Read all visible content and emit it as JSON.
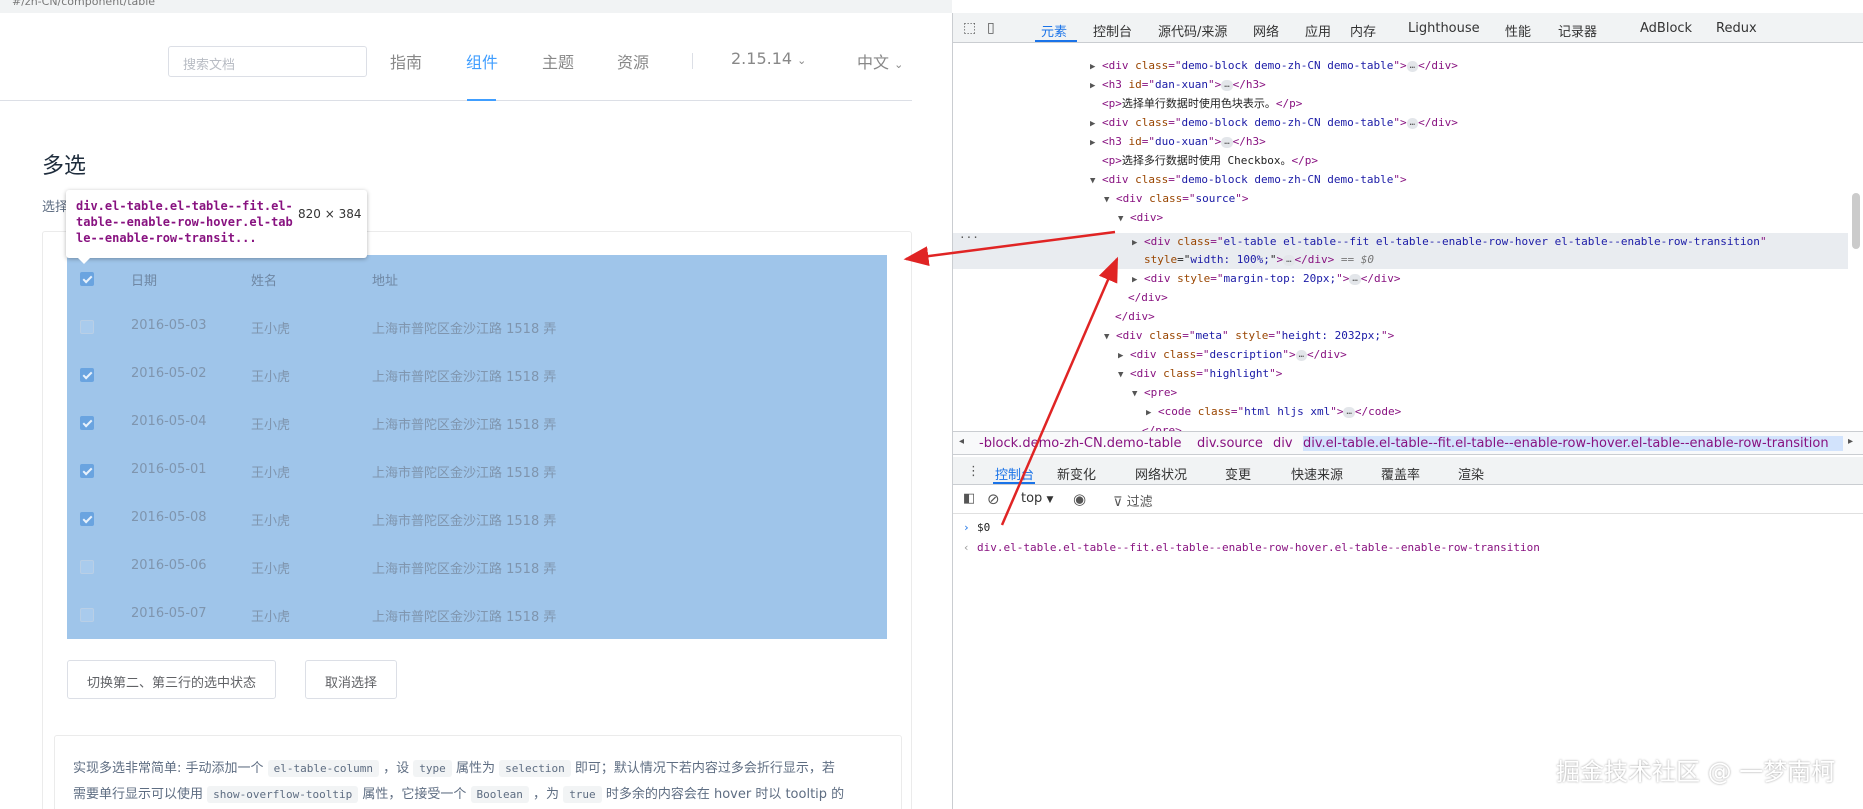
{
  "browser": {
    "url_fragment": "#/zh-CN/component/table"
  },
  "nav": {
    "search_placeholder": "搜索文档",
    "links": [
      "指南",
      "组件",
      "主题",
      "资源"
    ],
    "version": "2.15.14",
    "language": "中文"
  },
  "content": {
    "title": "多选",
    "intro": "选择",
    "table": {
      "headers": [
        "日期",
        "姓名",
        "地址"
      ],
      "rows": [
        {
          "date": "2016-05-03",
          "name": "王小虎",
          "address": "上海市普陀区金沙江路 1518 弄",
          "checked": false
        },
        {
          "date": "2016-05-02",
          "name": "王小虎",
          "address": "上海市普陀区金沙江路 1518 弄",
          "checked": true
        },
        {
          "date": "2016-05-04",
          "name": "王小虎",
          "address": "上海市普陀区金沙江路 1518 弄",
          "checked": true
        },
        {
          "date": "2016-05-01",
          "name": "王小虎",
          "address": "上海市普陀区金沙江路 1518 弄",
          "checked": true
        },
        {
          "date": "2016-05-08",
          "name": "王小虎",
          "address": "上海市普陀区金沙江路 1518 弄",
          "checked": true
        },
        {
          "date": "2016-05-06",
          "name": "王小虎",
          "address": "上海市普陀区金沙江路 1518 弄",
          "checked": false
        },
        {
          "date": "2016-05-07",
          "name": "王小虎",
          "address": "上海市普陀区金沙江路 1518 弄",
          "checked": false
        }
      ]
    },
    "buttons": {
      "toggle": "切换第二、第三行的选中状态",
      "clear": "取消选择"
    },
    "description": {
      "p1": "实现多选非常简单: 手动添加一个",
      "c1": "el-table-column",
      "p2": "，设",
      "c2": "type",
      "p3": "属性为",
      "c3": "selection",
      "p4": "即可；默认情况下若内容过多会折行显示，若",
      "p5": "需要单行显示可以使用",
      "c4": "show-overflow-tooltip",
      "p6": "属性，它接受一个",
      "c5": "Boolean",
      "p7": "，为",
      "c6": "true",
      "p8": "时多余的内容会在 hover 时以 tooltip 的"
    }
  },
  "tooltip": {
    "selector": "div.el-table.el-table--fit.el-table--enable-row-hover.el-table--enable-row-transit...",
    "size": "820 × 384"
  },
  "devtools": {
    "tabs": [
      "元素",
      "控制台",
      "源代码/来源",
      "网络",
      "应用",
      "内存",
      "Lighthouse",
      "性能",
      "记录器",
      "AdBlock",
      "Redux"
    ],
    "dom": {
      "l1": {
        "tag": "div",
        "attr": "class",
        "val": "demo-block demo-zh-CN demo-table"
      },
      "l2": {
        "tag": "h3",
        "attr": "id",
        "val": "dan-xuan"
      },
      "l3": "选择单行数据时使用色块表示。",
      "l4": {
        "tag": "div",
        "attr": "class",
        "val": "demo-block demo-zh-CN demo-table"
      },
      "l5": {
        "tag": "h3",
        "attr": "id",
        "val": "duo-xuan"
      },
      "l6": "选择多行数据时使用 Checkbox。",
      "l7": {
        "tag": "div",
        "attr": "class",
        "val": "demo-block demo-zh-CN demo-table"
      },
      "l8": {
        "tag": "div",
        "attr": "class",
        "val": "source"
      },
      "l9": "div",
      "l10": {
        "tag": "div",
        "attr": "class",
        "val": "el-table el-table--fit el-table--enable-row-hover el-table--enable-row-transition"
      },
      "l10b": {
        "attr": "style",
        "val": "width: 100%;",
        "eq": "== $0"
      },
      "l11": {
        "tag": "div",
        "attr": "style",
        "val": "margin-top: 20px;"
      },
      "l12": "div",
      "l13": "div",
      "l14": {
        "tag": "div",
        "attr": "class",
        "val": "meta",
        "attr2": "style",
        "val2": "height: 2032px;"
      },
      "l15": {
        "tag": "div",
        "attr": "class",
        "val": "description"
      },
      "l16": {
        "tag": "div",
        "attr": "class",
        "val": "highlight"
      },
      "l17": "pre",
      "l18": {
        "tag": "code",
        "attr": "class",
        "val": "html hljs xml"
      },
      "l19": "pre"
    },
    "breadcrumbs": [
      "-block.demo-zh-CN.demo-table",
      "div.source",
      "div",
      "div.el-table.el-table--fit.el-table--enable-row-hover.el-table--enable-row-transition"
    ],
    "drawer_tabs": [
      "控制台",
      "新变化",
      "网络状况",
      "变更",
      "快速来源",
      "覆盖率",
      "渲染"
    ],
    "console": {
      "context": "top",
      "filter": "过滤",
      "input": "$0",
      "output": "div.el-table.el-table--fit.el-table--enable-row-hover.el-table--enable-row-transition"
    }
  },
  "watermark": "掘金技术社区 @ 一梦南柯"
}
